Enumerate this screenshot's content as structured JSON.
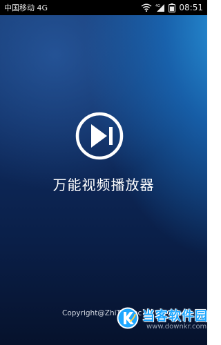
{
  "status_bar": {
    "carrier": "中国移动 4G",
    "network_badge": "4G",
    "time": "08:51",
    "icons": [
      "wifi-icon",
      "signal-icon",
      "battery-icon"
    ]
  },
  "splash": {
    "logo_icon": "play-next-icon",
    "title": "万能视频播放器",
    "copyright": "Copyright@ZhiTuo Inc"
  },
  "watermark": {
    "brand": "当客软件园",
    "url": "www.downkr.com"
  },
  "colors": {
    "background_top": "#173a72",
    "background_bottom": "#06122c",
    "accent_glow": "#2896dc",
    "watermark_blue": "#1ea7ff"
  }
}
